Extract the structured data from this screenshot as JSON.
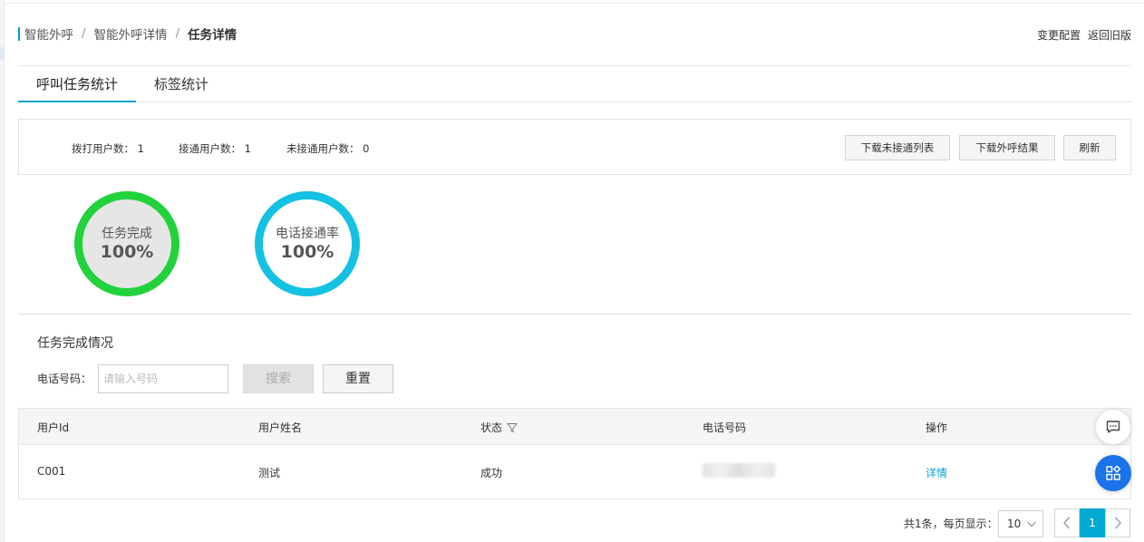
{
  "breadcrumb": {
    "items": [
      "智能外呼",
      "智能外呼详情",
      "任务详情"
    ],
    "separator": "/"
  },
  "header_actions": {
    "change_config": "变更配置",
    "back_old": "返回旧版"
  },
  "tabs": [
    {
      "label": "呼叫任务统计",
      "active": true
    },
    {
      "label": "标签统计",
      "active": false
    }
  ],
  "stats": {
    "dialed": "拨打用户数： 1",
    "connected": "接通用户数： 1",
    "not_connected": "未接通用户数： 0"
  },
  "actions": {
    "download_unconnected": "下载未接通列表",
    "download_results": "下载外呼结果",
    "refresh": "刷新"
  },
  "rings": {
    "completion": {
      "label": "任务完成",
      "value": "100%",
      "percent": 100,
      "color": "#22d23c"
    },
    "connect_rate": {
      "label": "电话接通率",
      "value": "100%",
      "percent": 100,
      "color": "#14c1e2"
    }
  },
  "task_section": {
    "title": "任务完成情况",
    "phone_label": "电话号码：",
    "phone_placeholder": "请输入号码",
    "search_label": "搜索",
    "reset_label": "重置"
  },
  "table": {
    "columns": [
      "用户Id",
      "用户姓名",
      "状态",
      "电话号码",
      "操作"
    ],
    "rows": [
      {
        "user_id": "C001",
        "name": "测试",
        "status": "成功",
        "phone": "",
        "action": "详情"
      }
    ]
  },
  "pagination": {
    "total_text": "共1条，每页显示：",
    "page_size": "10",
    "current_page": "1"
  },
  "colors": {
    "accent": "#00a2ca",
    "link": "#0aa3d4",
    "fab": "#1a73e8"
  }
}
